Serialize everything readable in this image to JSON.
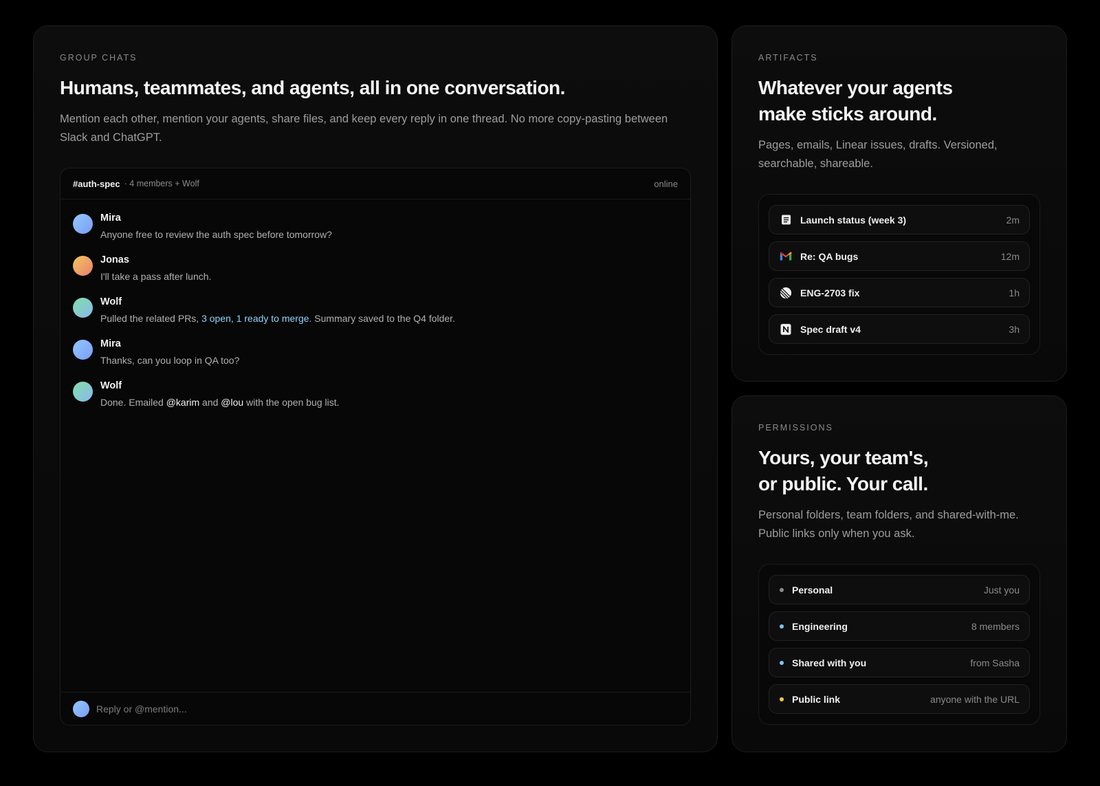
{
  "colors": {
    "page_background": "#000000",
    "border": "#1d1d1d",
    "accent_link": "#8fd4f7"
  },
  "group_chats": {
    "eyebrow": "GROUP CHATS",
    "title": "Humans, teammates, and agents, all in one conversation.",
    "description": "Mention each other, mention your agents, share files, and keep every reply in one thread. No more copy-pasting between Slack and ChatGPT.",
    "chat": {
      "channel": "#auth-spec",
      "meta": "· 4 members + Wolf",
      "status": "online",
      "messages": [
        {
          "author": "Mira",
          "avatar_colors": [
            "#93c8ff",
            "#7b9df5"
          ],
          "segments": [
            "Anyone free to review the auth spec before tomorrow?"
          ]
        },
        {
          "author": "Jonas",
          "avatar_colors": [
            "#f3c65c",
            "#e8806f"
          ],
          "segments": [
            "I'll take a pass after lunch."
          ]
        },
        {
          "author": "Wolf",
          "avatar_colors": [
            "#82e0a6",
            "#8ab8f0"
          ],
          "segments": [
            "Pulled the related PRs, ",
            "3 open, 1 ready to merge",
            ". Summary saved to the Q4 folder."
          ]
        },
        {
          "author": "Mira",
          "avatar_colors": [
            "#93c8ff",
            "#7b9df5"
          ],
          "segments": [
            "Thanks, can you loop in QA too?"
          ]
        },
        {
          "author": "Wolf",
          "avatar_colors": [
            "#82e0a6",
            "#8ab8f0"
          ],
          "segments": [
            "Done. Emailed ",
            "@karim",
            " and ",
            "@lou",
            " with the open bug list."
          ]
        }
      ],
      "composer": {
        "avatar_colors": [
          "#93c8ff",
          "#7b9df5"
        ],
        "placeholder": "Reply or @mention..."
      }
    }
  },
  "artifacts": {
    "eyebrow": "ARTIFACTS",
    "title_lines": [
      "Whatever your agents",
      "make sticks around."
    ],
    "description": "Pages, emails, Linear issues, drafts. Versioned, searchable, shareable.",
    "items": [
      {
        "icon": "doc-icon",
        "label": "Launch status (week 3)",
        "time": "2m"
      },
      {
        "icon": "gmail-icon",
        "label": "Re: QA bugs",
        "time": "12m"
      },
      {
        "icon": "linear-icon",
        "label": "ENG-2703 fix",
        "time": "1h"
      },
      {
        "icon": "notion-icon",
        "label": "Spec draft v4",
        "time": "3h"
      }
    ]
  },
  "permissions": {
    "eyebrow": "PERMISSIONS",
    "title_lines": [
      "Yours, your team's,",
      "or public. Your call."
    ],
    "description": "Personal folders, team folders, and shared-with-me. Public links only when you ask.",
    "items": [
      {
        "label": "Personal",
        "detail": "Just you",
        "dot_color": "#8c8c8c"
      },
      {
        "label": "Engineering",
        "detail": "8 members",
        "dot_color": "#7cc6f2"
      },
      {
        "label": "Shared with you",
        "detail": "from Sasha",
        "dot_color": "#7cc6f2"
      },
      {
        "label": "Public link",
        "detail": "anyone with the URL",
        "dot_color": "#f3c943"
      }
    ]
  }
}
